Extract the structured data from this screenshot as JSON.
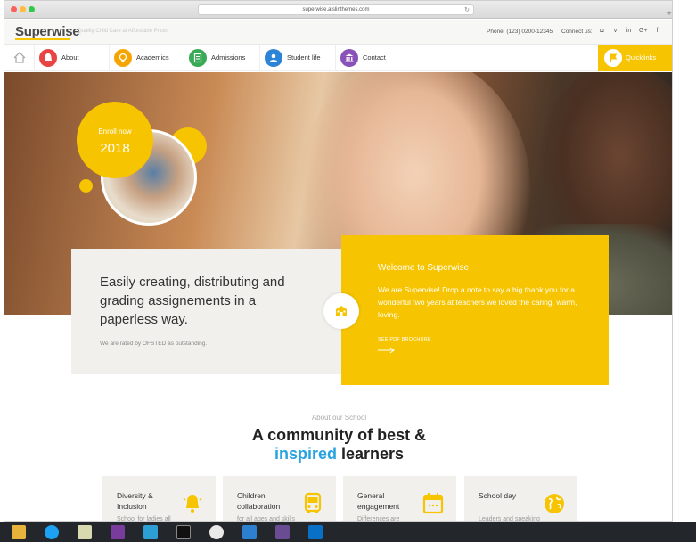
{
  "browser": {
    "url": "superwise.alslinthemes.com"
  },
  "header": {
    "logo": "Superwise",
    "tagline": "Quality Child Care at Affordable Prices",
    "phone": "Phone: (123) 0200-12345",
    "connect": "Connect us:",
    "social": [
      "instagram-icon",
      "vimeo-icon",
      "linkedin-icon",
      "google-plus-icon",
      "facebook-icon"
    ],
    "social_glyphs": [
      "◘",
      "v",
      "in",
      "G+",
      "f"
    ]
  },
  "nav": {
    "items": [
      {
        "label": "About",
        "color": "#e84444",
        "icon": "bell-icon"
      },
      {
        "label": "Academics",
        "color": "#f6a500",
        "icon": "bulb-icon"
      },
      {
        "label": "Admissions",
        "color": "#3aaa57",
        "icon": "clipboard-icon"
      },
      {
        "label": "Student life",
        "color": "#2d84d6",
        "icon": "user-icon"
      },
      {
        "label": "Contact",
        "color": "#8a52b8",
        "icon": "building-icon"
      }
    ],
    "quicklinks": "Quicklinks"
  },
  "hero": {
    "enroll_label": "Enroll now",
    "enroll_year": "2018"
  },
  "card_left": {
    "title": "Easily creating, distributing and grading assignements in a paperless way.",
    "subtitle": "We are rated by OFSTED as outstanding."
  },
  "card_right": {
    "title": "Welcome to Superwise",
    "text": "We are Supervise! Drop a note to say a big thank you for a wonderful two years at teachers we loved the caring, warm, loving.",
    "link": "SEE PDF BROCHURE"
  },
  "about": {
    "small": "About our School",
    "title_line1": "A community of best &",
    "title_accent": "inspired",
    "title_line2_rest": " learners"
  },
  "features": [
    {
      "title": "Diversity & Inclusion",
      "desc": "School for ladies all",
      "icon": "bell-icon"
    },
    {
      "title": "Children collaboration",
      "desc": "for all ages and skills",
      "icon": "bus-icon"
    },
    {
      "title": "General engagement",
      "desc": "Differences are central to",
      "icon": "calendar-icon"
    },
    {
      "title": "School day",
      "desc": "Leaders and speaking new",
      "icon": "globe-icon"
    }
  ],
  "colors": {
    "accent_yellow": "#f6c400",
    "accent_blue": "#29a3e0"
  },
  "taskbar": {
    "apps": [
      "file-explorer-icon",
      "skype-icon",
      "notepad-icon",
      "onenote-icon",
      "app-icon",
      "terminal-icon",
      "paint-icon",
      "vscode-icon",
      "git-icon",
      "outlook-icon"
    ]
  }
}
